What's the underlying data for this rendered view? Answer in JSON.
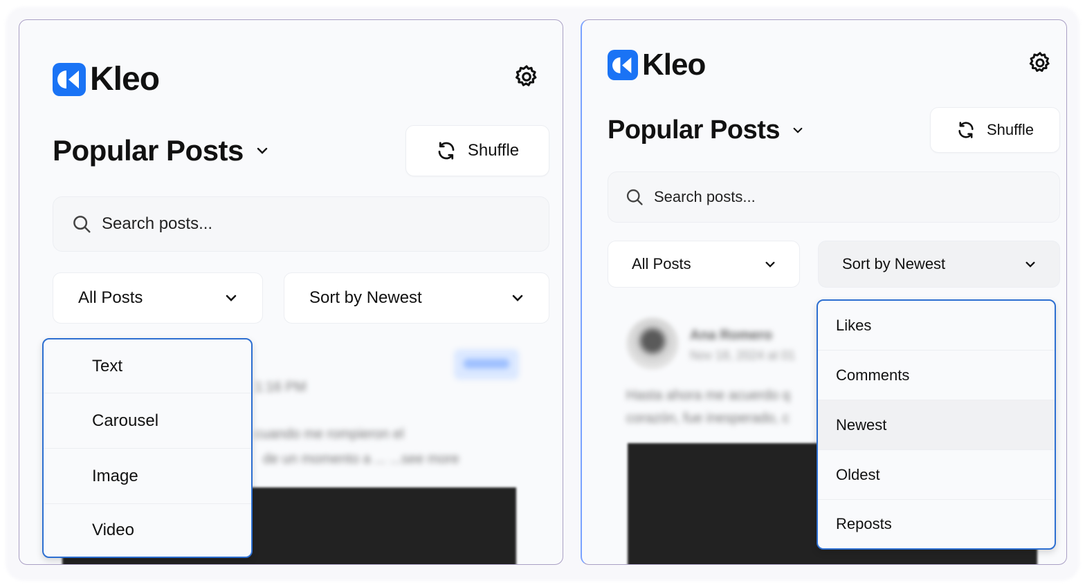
{
  "app": {
    "brand": "Kleo",
    "accent_color": "#1a73f5",
    "dropdown_border_color": "#2d6fd1"
  },
  "left_panel": {
    "header": {
      "logo_text": "Kleo",
      "settings_icon": "gear-icon"
    },
    "title": "Popular Posts",
    "shuffle_label": "Shuffle",
    "search": {
      "placeholder": "Search posts...",
      "value": ""
    },
    "filter_select": {
      "value": "All Posts"
    },
    "sort_select": {
      "value": "Sort by Newest"
    },
    "filter_dropdown": {
      "open": true,
      "items": [
        {
          "label": "Text"
        },
        {
          "label": "Carousel"
        },
        {
          "label": "Image"
        },
        {
          "label": "Video"
        }
      ]
    },
    "blurred_post": {
      "timestamp_fragment": "1:16 PM",
      "text_line_1": "cuando me rompieron el",
      "text_line_2": "de un momento a ... ...see more",
      "badge": "Image"
    }
  },
  "right_panel": {
    "header": {
      "logo_text": "Kleo",
      "settings_icon": "gear-icon"
    },
    "title": "Popular Posts",
    "shuffle_label": "Shuffle",
    "search": {
      "placeholder": "Search posts...",
      "value": ""
    },
    "filter_select": {
      "value": "All Posts"
    },
    "sort_select": {
      "value": "Sort by Newest"
    },
    "sort_dropdown": {
      "open": true,
      "highlighted": "Newest",
      "items": [
        {
          "label": "Likes"
        },
        {
          "label": "Comments"
        },
        {
          "label": "Newest"
        },
        {
          "label": "Oldest"
        },
        {
          "label": "Reposts"
        }
      ]
    },
    "blurred_post": {
      "author": "Ana Romero",
      "timestamp": "Nov 18, 2024 at 01",
      "text_line_1": "Hasta ahora me acuerdo q",
      "text_line_2": "corazón, fue inesperado, c"
    }
  }
}
